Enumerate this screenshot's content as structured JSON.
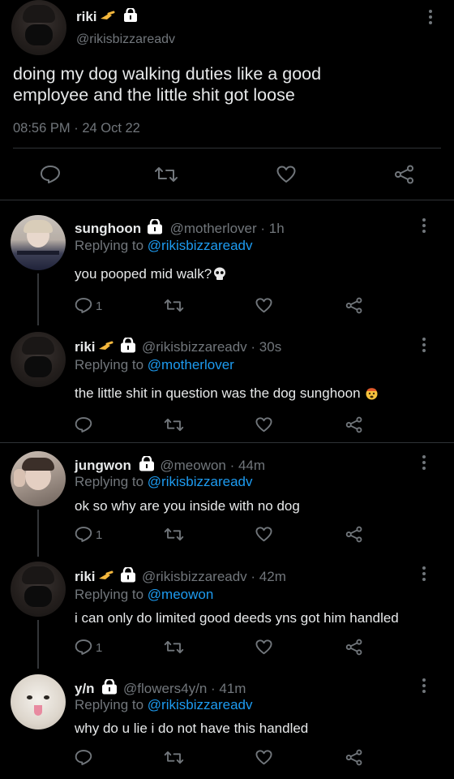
{
  "main_tweet": {
    "name": "riki",
    "handle": "@rikisbizzareadv",
    "text_line1": "doing my dog walking duties like a good",
    "text_line2": "employee and the little shit got loose",
    "time": "08:56 PM",
    "dot": "·",
    "date": "24 Oct 22"
  },
  "replies": [
    {
      "name": "sunghoon",
      "handle": "@motherlover",
      "time": "· 1h",
      "replying_label": "Replying to",
      "replying_to": "@rikisbizzareadv",
      "text": "you pooped mid walk?",
      "reply_count": "1"
    },
    {
      "name": "riki",
      "handle": "@rikisbizzareadv",
      "time": "· 30s",
      "replying_label": "Replying to",
      "replying_to": "@motherlover",
      "text": "the little shit in question was the dog sunghoon",
      "reply_count": ""
    },
    {
      "name": "jungwon",
      "handle": "@meowon",
      "time": "· 44m",
      "replying_label": "Replying to",
      "replying_to": "@rikisbizzareadv",
      "text": "ok so why are you inside with no dog",
      "reply_count": "1"
    },
    {
      "name": "riki",
      "handle": "@rikisbizzareadv",
      "time": "· 42m",
      "replying_label": "Replying to",
      "replying_to": "@meowon",
      "text": "i can only do limited good deeds yns got him handled",
      "reply_count": "1"
    },
    {
      "name": "y/n",
      "handle": "@flowers4y/n",
      "time": "· 41m",
      "replying_label": "Replying to",
      "replying_to": "@rikisbizzareadv",
      "text": "why do u lie i do not have this handled",
      "reply_count": ""
    }
  ],
  "colors": {
    "background": "#000000",
    "text": "#e7e9ea",
    "muted": "#71767b",
    "link": "#1d9bf0",
    "divider": "#2f3336"
  }
}
